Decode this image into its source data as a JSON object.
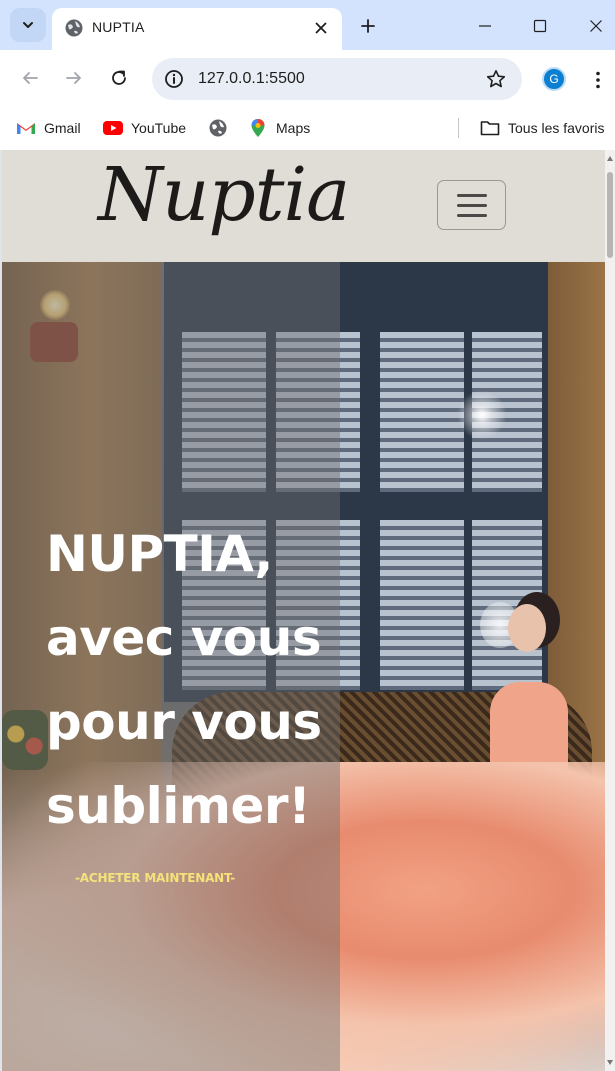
{
  "browser": {
    "tab": {
      "title": "NUPTIA"
    },
    "address_bar": {
      "url": "127.0.0.1:5500"
    },
    "profile": {
      "initial": "G"
    },
    "bookmarks": [
      {
        "label": "Gmail",
        "icon": "gmail-icon"
      },
      {
        "label": "YouTube",
        "icon": "youtube-icon"
      },
      {
        "label": "",
        "icon": "globe-icon"
      },
      {
        "label": "Maps",
        "icon": "maps-icon"
      }
    ],
    "all_bookmarks_label": "Tous les favoris"
  },
  "site": {
    "logo": "Nuptia",
    "hero": {
      "title_lines": [
        "NUPTIA,",
        "avec vous",
        "pour vous",
        "sublimer!"
      ],
      "cta": "-ACHETER MAINTENANT-"
    }
  },
  "colors": {
    "tabstrip": "#d3e3fd",
    "header_bg": "#e0ddd6",
    "cta_text": "#f5e27a",
    "profile_avatar": "#0b7fd1"
  }
}
